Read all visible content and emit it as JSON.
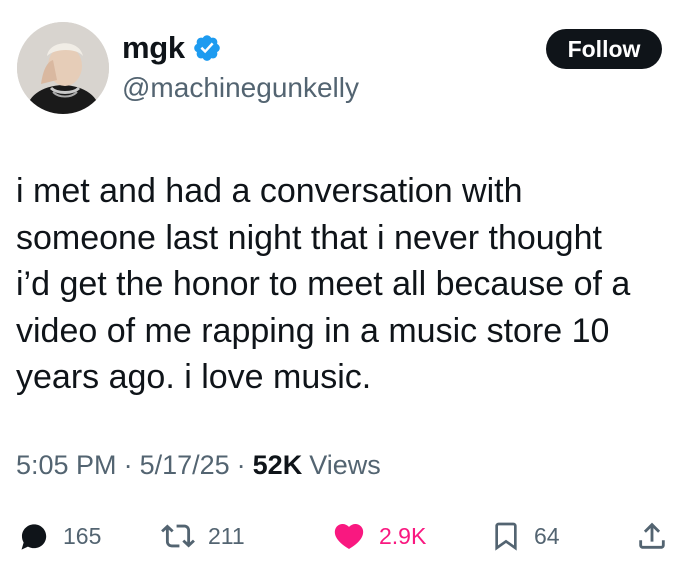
{
  "author": {
    "display_name": "mgk",
    "handle": "@machinegunkelly",
    "verified": true
  },
  "follow_button": {
    "label": "Follow"
  },
  "tweet": {
    "text": "i met and had a conversation with\nsomeone last night that i never thought\ni’d get the honor to meet all because of a\nvideo of me rapping in a music store 10\nyears ago. i love music."
  },
  "meta": {
    "time": "5:05 PM",
    "separator": "·",
    "date": "5/17/25",
    "views_count": "52K",
    "views_label": "Views"
  },
  "actions": {
    "replies": "165",
    "reposts": "211",
    "likes": "2.9K",
    "bookmarks": "64"
  },
  "icons": [
    "verified-badge-icon",
    "reply-icon",
    "repost-icon",
    "heart-icon",
    "bookmark-icon",
    "share-icon"
  ],
  "colors": {
    "text_primary": "#0f1419",
    "text_secondary": "#536471",
    "verified_blue": "#1d9bf0",
    "like_pink": "#f91880",
    "follow_bg": "#0f1419"
  }
}
